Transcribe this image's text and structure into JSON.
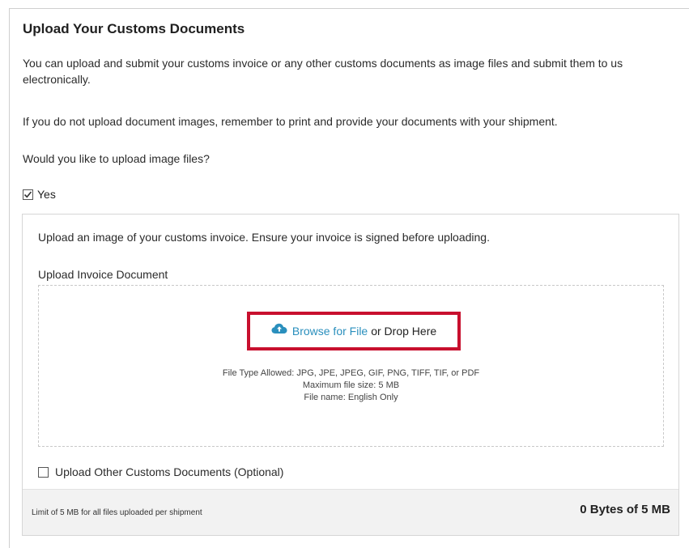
{
  "section": {
    "title": "Upload Your Customs Documents",
    "intro": "You can upload and submit your customs invoice or any other customs documents as image files and submit them to us electronically.",
    "reminder": "If you do not upload document images, remember to print and provide your documents with your shipment.",
    "question": "Would you like to upload image files?",
    "yes_checkbox": {
      "label": "Yes",
      "checked": true
    }
  },
  "invoice_upload": {
    "instruction": "Upload an image of your customs invoice. Ensure your invoice is signed before uploading.",
    "label": "Upload Invoice Document",
    "icon": "cloud-upload-icon",
    "browse_link": "Browse for File",
    "drop_text": "or Drop Here",
    "file_types": "File Type Allowed: JPG, JPE, JPEG, GIF, PNG, TIFF, TIF, or PDF",
    "max_size": "Maximum file size: 5 MB",
    "file_name_rule": "File name: English Only",
    "highlight_color": "#c8102e",
    "link_color": "#2a8fbd"
  },
  "other_documents": {
    "label": "Upload Other Customs Documents (Optional)",
    "checked": false
  },
  "footer": {
    "limit_text": "Limit of 5 MB for all files uploaded per shipment",
    "usage_text": "0 Bytes of 5 MB"
  }
}
